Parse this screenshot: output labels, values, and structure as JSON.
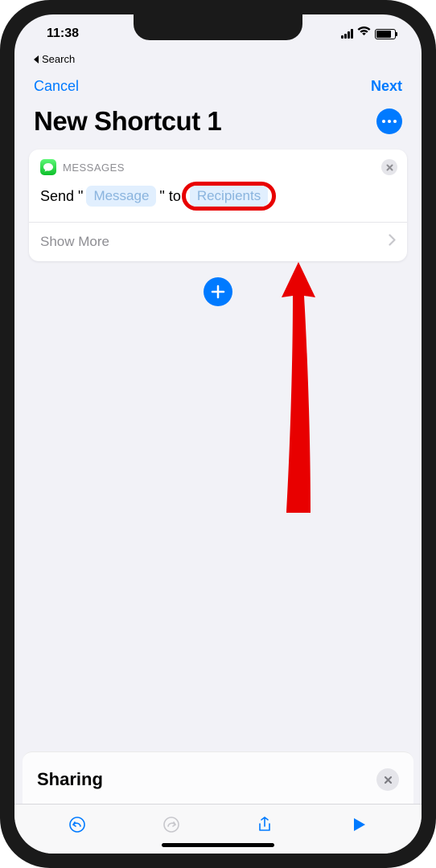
{
  "status": {
    "time": "11:38",
    "back_app": "Search"
  },
  "nav": {
    "cancel": "Cancel",
    "next": "Next"
  },
  "page": {
    "title": "New Shortcut 1"
  },
  "action": {
    "app_label": "MESSAGES",
    "prefix": "Send \"",
    "message_token": "Message",
    "middle": "\" to",
    "recipients_token": "Recipients",
    "show_more": "Show More"
  },
  "sheet": {
    "title": "Sharing"
  }
}
